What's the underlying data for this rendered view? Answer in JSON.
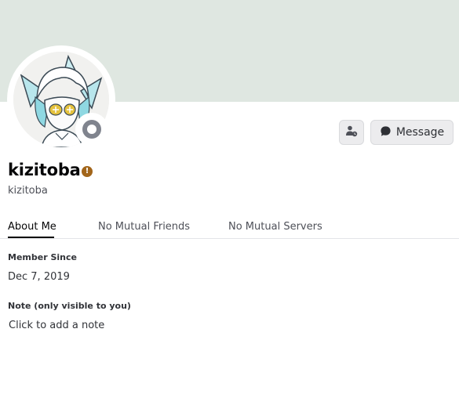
{
  "profile": {
    "display_name": "kizitoba",
    "username": "kizitoba",
    "status": "offline",
    "badge_symbol": "!"
  },
  "actions": {
    "message_label": "Message",
    "friend_icon": "add-friend-icon"
  },
  "tabs": [
    {
      "label": "About Me",
      "active": true
    },
    {
      "label": "No Mutual Friends",
      "active": false
    },
    {
      "label": "No Mutual Servers",
      "active": false
    }
  ],
  "about": {
    "member_since_heading": "Member Since",
    "member_since_value": "Dec 7, 2019",
    "note_heading": "Note (only visible to you)",
    "note_placeholder": "Click to add a note"
  },
  "colors": {
    "banner": "#dfe7e1",
    "status_offline": "#80848e",
    "warning_badge": "#a2651a"
  }
}
